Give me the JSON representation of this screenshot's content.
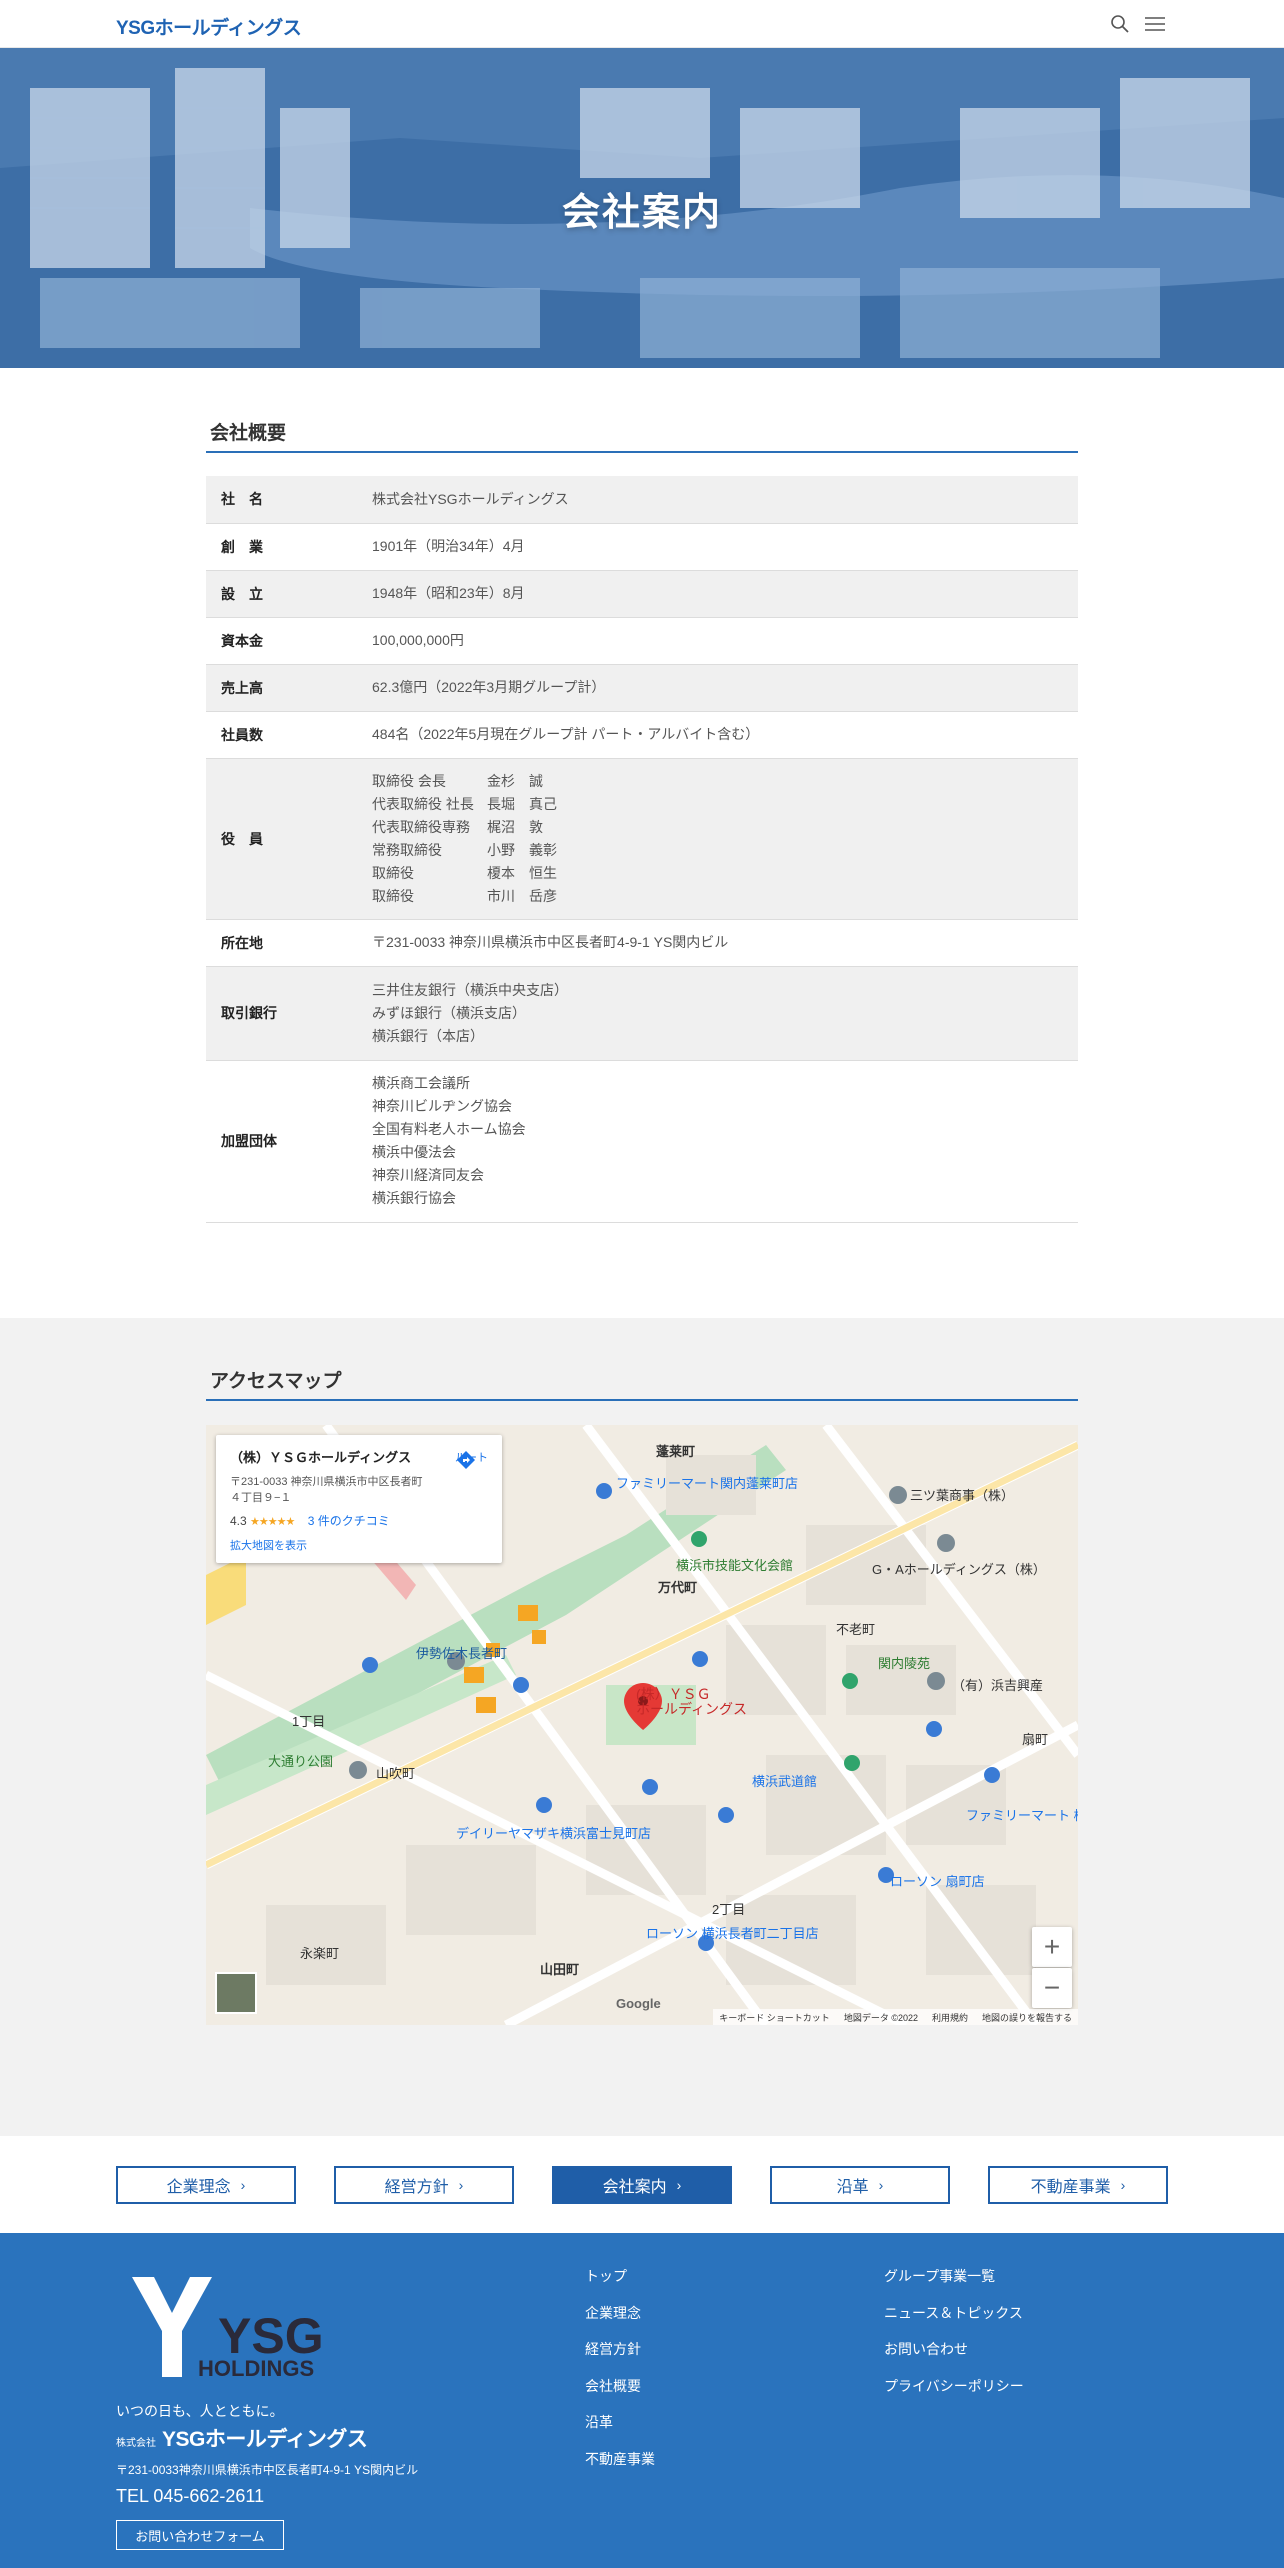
{
  "header": {
    "logo": "YSGホールディングス",
    "icons": [
      "search-icon",
      "menu-icon"
    ]
  },
  "hero": {
    "title": "会社案内"
  },
  "overview": {
    "heading": "会社概要",
    "rows": [
      {
        "label": "社　名",
        "lines": [
          "株式会社YSGホールディングス"
        ]
      },
      {
        "label": "創　業",
        "lines": [
          "1901年（明治34年）4月"
        ]
      },
      {
        "label": "設　立",
        "lines": [
          "1948年（昭和23年）8月"
        ]
      },
      {
        "label": "資本金",
        "lines": [
          "100,000,000円"
        ]
      },
      {
        "label": "売上高",
        "lines": [
          "62.3億円（2022年3月期グループ計）"
        ]
      },
      {
        "label": "社員数",
        "lines": [
          "484名（2022年5月現在グループ計 パート・アルバイト含む）"
        ]
      },
      {
        "label": "役　員",
        "officers": [
          {
            "role": "取締役 会長",
            "name": "金杉　誠"
          },
          {
            "role": "代表取締役 社長",
            "name": "長堀　真己"
          },
          {
            "role": "代表取締役専務",
            "name": "梶沼　敦"
          },
          {
            "role": "常務取締役",
            "name": "小野　義彰"
          },
          {
            "role": "取締役",
            "name": "榎本　恒生"
          },
          {
            "role": "取締役",
            "name": "市川　岳彦"
          }
        ]
      },
      {
        "label": "所在地",
        "lines": [
          "〒231-0033 神奈川県横浜市中区長者町4-9-1 YS関内ビル"
        ]
      },
      {
        "label": "取引銀行",
        "lines": [
          "三井住友銀行（横浜中央支店）",
          "みずほ銀行（横浜支店）",
          "横浜銀行（本店）"
        ]
      },
      {
        "label": "加盟団体",
        "lines": [
          "横浜商工会議所",
          "神奈川ビルヂング協会",
          "全国有料老人ホーム協会",
          "横浜中優法会",
          "神奈川経済同友会",
          "横浜銀行協会"
        ]
      }
    ]
  },
  "access": {
    "heading": "アクセスマップ",
    "card": {
      "title": "（株）ＹＳＧホールディングス",
      "address": "〒231-0033 神奈川県横浜市中区長者町４丁目９−１",
      "rating": "4.3",
      "stars": "★★★★★",
      "reviews": "3 件のクチコミ",
      "enlarge": "拡大地図を表示",
      "route": "ルート"
    },
    "map_labels": {
      "marker": "(株）ＹＳＧ\nホールディングス",
      "l1": "三ツ葉商事（株）",
      "l2": "G・Aホールディングス（株）",
      "l3": "ファミリーマート関内蓬莱町店",
      "l4": "横浜市技能文化会館",
      "l5": "万代町",
      "l6": "不老町",
      "l7": "関内陵苑",
      "l8": "（有）浜吉興産",
      "l9": "伊勢佐木長者町",
      "l10": "山吹町",
      "l11": "デイリーヤマザキ横浜富士見町店",
      "l12": "ローソン 横浜長者町二丁目店",
      "l13": "山田町",
      "l14": "永楽町",
      "l15": "ローソン 扇町店",
      "l16": "ファミリーマート 横浜ポートピア横浜",
      "l17": "横浜武道館",
      "l18": "蓬莱町",
      "l19": "扇町",
      "l20": "2丁目",
      "l21": "大通り公園",
      "l22": "1丁目"
    },
    "footer_text": [
      "キーボード ショートカット",
      "地図データ ©2022",
      "利用規約",
      "地図の誤りを報告する"
    ],
    "zoom_in": "+",
    "zoom_out": "−",
    "google": "Google"
  },
  "nav": {
    "buttons": [
      {
        "label": "企業理念",
        "active": false
      },
      {
        "label": "経営方針",
        "active": false
      },
      {
        "label": "会社案内",
        "active": true
      },
      {
        "label": "沿革",
        "active": false
      },
      {
        "label": "不動産事業",
        "active": false
      }
    ]
  },
  "footer": {
    "logo_text": "YSG",
    "logo_sub": "HOLDINGS",
    "tagline": "いつの日も、人とともに。",
    "corp_prefix": "株式会社",
    "corp_name": "YSGホールディングス",
    "address": "〒231-0033神奈川県横浜市中区長者町4-9-1 YS関内ビル",
    "tel": "TEL 045-662-2611",
    "contact_button": "お問い合わせフォーム",
    "links_col1": [
      "トップ",
      "企業理念",
      "経営方針",
      "会社概要",
      "沿革",
      "不動産事業"
    ],
    "links_col2": [
      "グループ事業一覧",
      "ニュース＆トピックス",
      "お問い合わせ",
      "プライバシーポリシー"
    ]
  },
  "colors": {
    "brand": "#1f5ea8",
    "footer_bg": "#2a73bd",
    "accent_line": "#2a6fb8"
  }
}
